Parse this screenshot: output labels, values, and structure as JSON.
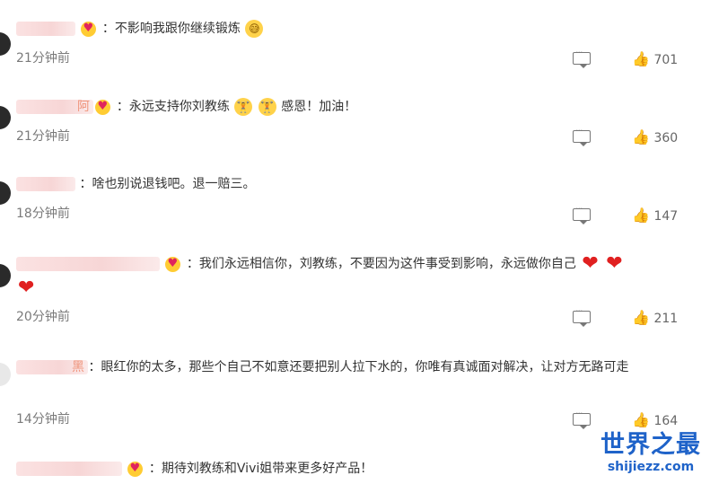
{
  "comments": [
    {
      "name": "",
      "text": "：不影响我跟你继续锻炼",
      "time": "21分钟前",
      "likes": "701",
      "emoji_after": "sweat-smile"
    },
    {
      "name": "阿",
      "text": "：永远支持你刘教练",
      "text_after": "感恩！加油！",
      "time": "21分钟前",
      "likes": "360"
    },
    {
      "name": "",
      "text": "：啥也别说退钱吧。退一赔三。",
      "time": "18分钟前",
      "likes": "147"
    },
    {
      "name": "",
      "text": "：我们永远相信你，刘教练，不要因为这件事受到影响，永远做你自己",
      "time": "20分钟前",
      "likes": "211"
    },
    {
      "name": "黑",
      "text": "：眼红你的太多，那些个自己不如意还要把别人拉下水的，你唯有真诚面对解决，让对方无路可走",
      "time": "14分钟前",
      "likes": "164"
    },
    {
      "name": "",
      "text": "：期待刘教练和Vivi姐带来更多好产品！"
    }
  ],
  "watermark": {
    "title": "世界之最",
    "url": "shijiezz.com"
  },
  "colors": {
    "accent_blue": "#1f63c9",
    "heart_red": "#e02020",
    "time_gray": "#7a7a7a"
  }
}
